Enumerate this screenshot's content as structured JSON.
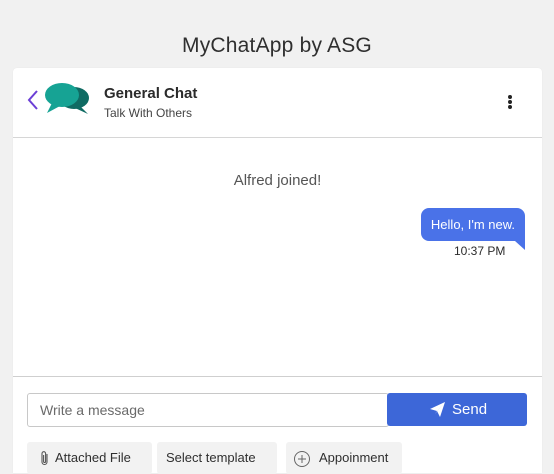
{
  "app": {
    "title": "MyChatApp by ASG"
  },
  "header": {
    "chat_name": "General Chat",
    "chat_subtitle": "Talk With Others",
    "back_icon": "chevron-left-icon",
    "logo_icon": "chat-bubbles-icon",
    "menu_icon": "more-vertical-icon"
  },
  "messages": {
    "system_message": "Alfred joined!",
    "items": [
      {
        "text": "Hello, I'm new.",
        "time": "10:37 PM",
        "outgoing": true
      }
    ]
  },
  "composer": {
    "input_placeholder": "Write a message",
    "input_value": "",
    "send_label": "Send",
    "send_icon": "paper-plane-icon",
    "actions": [
      {
        "label": "Attached File",
        "icon": "paperclip-icon"
      },
      {
        "label": "Select template",
        "icon": ""
      },
      {
        "label": "Appoinment",
        "icon": "plus-circle-icon"
      }
    ]
  },
  "colors": {
    "page_background": "#f1f1f1",
    "accent_blue": "#3d67d8",
    "bubble_blue": "#4a72e8",
    "back_arrow": "#6b3fd6",
    "logo_teal": "#16a394",
    "logo_dark_teal": "#0f6b63"
  }
}
